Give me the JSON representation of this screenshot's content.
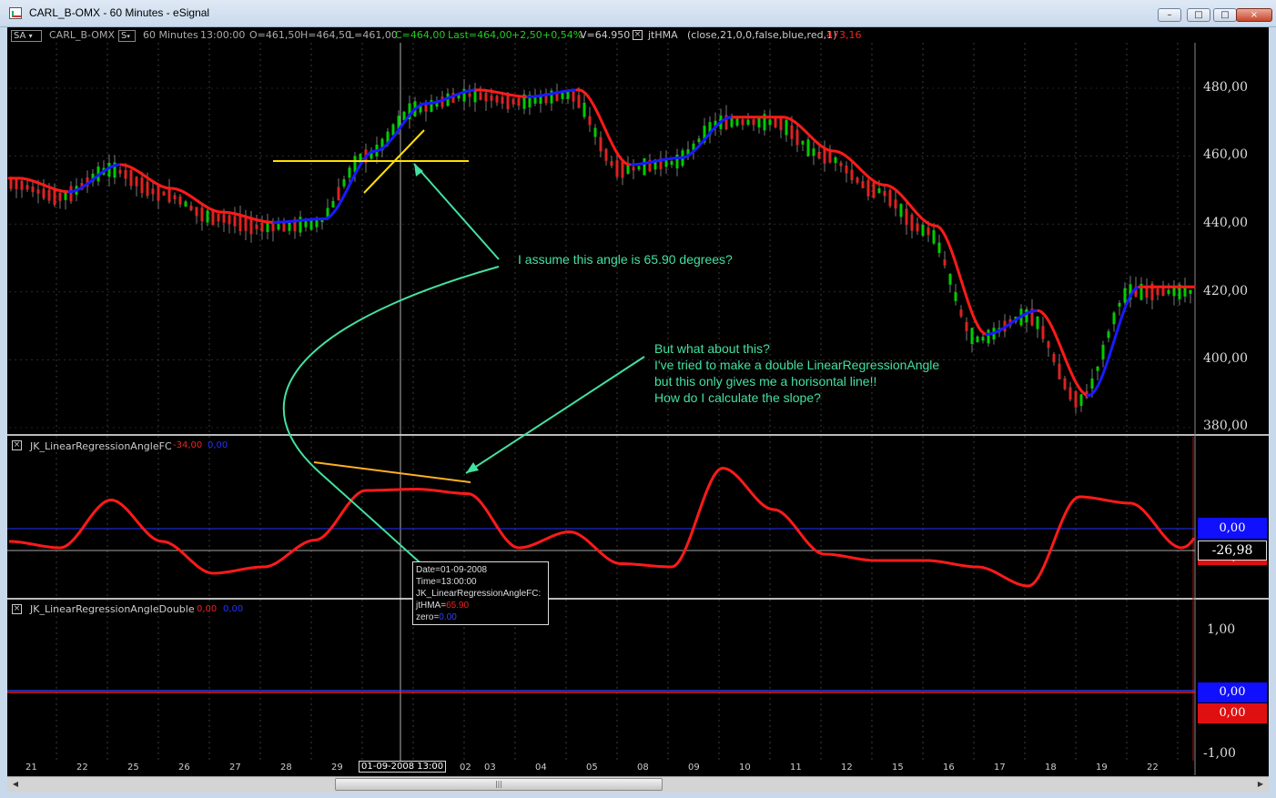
{
  "window": {
    "title": "CARL_B-OMX - 60 Minutes - eSignal",
    "minimize_label": "–",
    "maximize_label": "□",
    "close_label": "×"
  },
  "header": {
    "sa_label": "SA",
    "symbol": "CARL_B-OMX",
    "s_label": "S",
    "interval": "60 Minutes",
    "time": "13:00:00",
    "open": "O=461,50",
    "high": "H=464,50",
    "low": "L=461,00",
    "close": "C=464,00",
    "last": "Last=464,00",
    "change": "+2,50",
    "change_pct": "+0,54%",
    "volume": "V=64.950",
    "study_name": "jtHMA",
    "study_params": "(close,21,0,0,false,blue,red,1)",
    "study_value": "473,16"
  },
  "panes": {
    "angle_fc": {
      "name": "JK_LinearRegressionAngleFC",
      "value1": "-34,00",
      "value2": "0,00"
    },
    "angle_double": {
      "name": "JK_LinearRegressionAngleDouble",
      "value1": "0,00",
      "value2": "0,00"
    }
  },
  "annotations": {
    "angle_question": "I assume this angle is 65.90 degrees?",
    "lines": [
      "But what about this?",
      "I've tried to make a double LinearRegressionAngle",
      "but this only gives me a horisontal line!!",
      "How do I calculate the slope?"
    ]
  },
  "tooltip": {
    "date": "Date=01-09-2008",
    "time": "Time=13:00:00",
    "study": "JK_LinearRegressionAngleFC:",
    "hma_label": "jtHMA=",
    "hma_value": "65.90",
    "zero_label": "zero=",
    "zero_value": "0.00"
  },
  "price_axis": [
    "480,00",
    "460,00",
    "440,00",
    "420,00",
    "400,00",
    "380,00"
  ],
  "mid_axis": {
    "zero": "0,00",
    "current": "-26,98",
    "hidden": "-34,00"
  },
  "bottom_axis": {
    "one": "1,00",
    "zero_a": "0,00",
    "zero_b": "0,00",
    "minus_one": "-1,00"
  },
  "x_axis": [
    "21",
    "22",
    "25",
    "26",
    "27",
    "28",
    "29",
    "01-09-2008 13:00",
    "02",
    "03",
    "04",
    "05",
    "08",
    "09",
    "10",
    "11",
    "12",
    "15",
    "16",
    "17",
    "18",
    "19",
    "22"
  ],
  "colors": {
    "bull": "#00cc00",
    "bear": "#dd2222",
    "hma_up": "#1a1aff",
    "hma_down": "#ff1a1a",
    "annotation": "#44e0a0",
    "yellow": "#ffe000",
    "orange": "#ffb020"
  },
  "chart_data": {
    "type": "line",
    "x": [
      "21",
      "22",
      "25",
      "26",
      "27",
      "28",
      "29",
      "01",
      "02",
      "03",
      "04",
      "05",
      "08",
      "09",
      "10",
      "11",
      "12",
      "15",
      "16",
      "17",
      "18",
      "19",
      "22"
    ],
    "series": [
      {
        "values": [
          452,
          448,
          456,
          449,
          442,
          439,
          440,
          460,
          474,
          478,
          476,
          478,
          456,
          458,
          470,
          470,
          460,
          450,
          438,
          406,
          413,
          388,
          420
        ]
      }
    ],
    "ylim": [
      380,
      490
    ],
    "yticks": [
      380,
      400,
      420,
      440,
      460,
      480
    ],
    "indicators": [
      {
        "values": [
          -20,
          -30,
          45,
          -20,
          -70,
          -60,
          -18,
          60,
          62,
          55,
          -30,
          -5,
          -55,
          -60,
          95,
          30,
          -40,
          -50,
          -50,
          -60,
          -90,
          50,
          40,
          -30
        ],
        "zero": 0,
        "current": -26.98
      },
      {
        "values": [
          0,
          0
        ],
        "yticks": [
          1.0,
          0,
          -1.0
        ]
      }
    ]
  }
}
